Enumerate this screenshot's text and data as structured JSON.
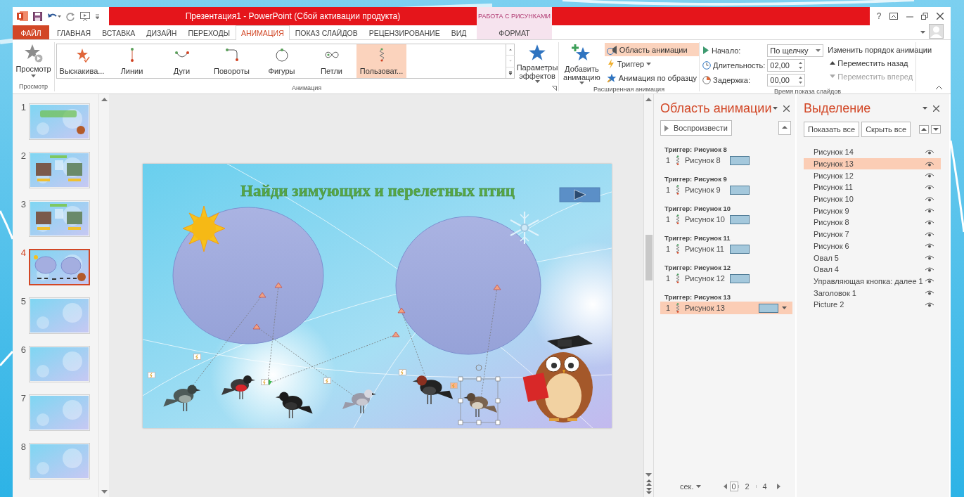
{
  "window": {
    "title": "Презентация1 -  PowerPoint (Сбой активации продукта)",
    "help": "?"
  },
  "contextual_group": {
    "label": "РАБОТА С РИСУНКАМИ"
  },
  "tabs": [
    {
      "label": "ФАЙЛ",
      "kind": "file",
      "selected": false
    },
    {
      "label": "ГЛАВНАЯ",
      "kind": "normal",
      "selected": false
    },
    {
      "label": "ВСТАВКА",
      "kind": "normal",
      "selected": false
    },
    {
      "label": "ДИЗАЙН",
      "kind": "normal",
      "selected": false
    },
    {
      "label": "ПЕРЕХОДЫ",
      "kind": "normal",
      "selected": false
    },
    {
      "label": "АНИМАЦИЯ",
      "kind": "normal",
      "selected": true
    },
    {
      "label": "ПОКАЗ СЛАЙДОВ",
      "kind": "normal",
      "selected": false
    },
    {
      "label": "РЕЦЕНЗИРОВАНИЕ",
      "kind": "normal",
      "selected": false
    },
    {
      "label": "ВИД",
      "kind": "normal",
      "selected": false
    },
    {
      "label": "ФОРМАТ",
      "kind": "contextual",
      "selected": false
    }
  ],
  "ribbon": {
    "preview": {
      "label": "Просмотр",
      "group_label": "Просмотр"
    },
    "animation": {
      "effects": [
        {
          "label": "Выскакива...",
          "kind": "pop",
          "selected": false
        },
        {
          "label": "Линии",
          "kind": "line",
          "selected": false
        },
        {
          "label": "Дуги",
          "kind": "arc",
          "selected": false
        },
        {
          "label": "Повороты",
          "kind": "turn",
          "selected": false
        },
        {
          "label": "Фигуры",
          "kind": "shape",
          "selected": false
        },
        {
          "label": "Петли",
          "kind": "loop",
          "selected": false
        },
        {
          "label": "Пользоват...",
          "kind": "custom",
          "selected": true
        }
      ],
      "effect_options": "Параметры эффектов",
      "group_label": "Анимация"
    },
    "advanced": {
      "add_animation": "Добавить анимацию",
      "animation_pane": {
        "label": "Область анимации",
        "on": true
      },
      "trigger": "Триггер",
      "animation_painter": "Анимация по образцу",
      "group_label": "Расширенная анимация"
    },
    "timing": {
      "start": {
        "label": "Начало:",
        "value": "По щелчку"
      },
      "duration": {
        "label": "Длительность:",
        "value": "02,00"
      },
      "delay": {
        "label": "Задержка:",
        "value": "00,00"
      },
      "reorder_heading": "Изменить порядок анимации",
      "move_earlier": {
        "label": "Переместить назад",
        "disabled": false
      },
      "move_later": {
        "label": "Переместить вперед",
        "disabled": true
      },
      "group_label": "Время показа слайдов"
    }
  },
  "thumbnails": [
    {
      "number": "1",
      "kind": "title",
      "selected": false
    },
    {
      "number": "2",
      "kind": "photos",
      "selected": false
    },
    {
      "number": "3",
      "kind": "photos",
      "selected": false
    },
    {
      "number": "4",
      "kind": "ovals",
      "selected": true
    },
    {
      "number": "5",
      "kind": "blank",
      "selected": false
    },
    {
      "number": "6",
      "kind": "blank",
      "selected": false
    },
    {
      "number": "7",
      "kind": "blank",
      "selected": false
    },
    {
      "number": "8",
      "kind": "blank",
      "selected": false
    }
  ],
  "slide": {
    "title": "Найди зимующих и перелетных птиц"
  },
  "animation_pane": {
    "title": "Область анимации",
    "play_button": "Воспроизвести",
    "groups": [
      {
        "trigger": "Триггер: Рисунок 8",
        "items": [
          {
            "order": "1",
            "name": "Рисунок 8",
            "selected": false
          }
        ]
      },
      {
        "trigger": "Триггер: Рисунок 9",
        "items": [
          {
            "order": "1",
            "name": "Рисунок 9",
            "selected": false
          }
        ]
      },
      {
        "trigger": "Триггер: Рисунок 10",
        "items": [
          {
            "order": "1",
            "name": "Рисунок 10",
            "selected": false
          }
        ]
      },
      {
        "trigger": "Триггер: Рисунок 11",
        "items": [
          {
            "order": "1",
            "name": "Рисунок 11",
            "selected": false
          }
        ]
      },
      {
        "trigger": "Триггер: Рисунок 12",
        "items": [
          {
            "order": "1",
            "name": "Рисунок 12",
            "selected": false
          }
        ]
      },
      {
        "trigger": "Триггер: Рисунок 13",
        "items": [
          {
            "order": "1",
            "name": "Рисунок 13",
            "selected": true
          }
        ]
      }
    ],
    "timeline": {
      "unit": "сек.",
      "ticks": [
        "0",
        "2",
        "4"
      ]
    }
  },
  "selection_pane": {
    "title": "Выделение",
    "show_all": "Показать все",
    "hide_all": "Скрыть все",
    "items": [
      {
        "name": "Рисунок 14",
        "selected": false,
        "visible": true
      },
      {
        "name": "Рисунок 13",
        "selected": true,
        "visible": true
      },
      {
        "name": "Рисунок 12",
        "selected": false,
        "visible": true
      },
      {
        "name": "Рисунок 11",
        "selected": false,
        "visible": true
      },
      {
        "name": "Рисунок 10",
        "selected": false,
        "visible": true
      },
      {
        "name": "Рисунок 9",
        "selected": false,
        "visible": true
      },
      {
        "name": "Рисунок 8",
        "selected": false,
        "visible": true
      },
      {
        "name": "Рисунок 7",
        "selected": false,
        "visible": true
      },
      {
        "name": "Рисунок 6",
        "selected": false,
        "visible": true
      },
      {
        "name": "Овал 5",
        "selected": false,
        "visible": true
      },
      {
        "name": "Овал 4",
        "selected": false,
        "visible": true
      },
      {
        "name": "Управляющая кнопка: далее 1",
        "selected": false,
        "visible": true
      },
      {
        "name": "Заголовок 1",
        "selected": false,
        "visible": true
      },
      {
        "name": "Picture 2",
        "selected": false,
        "visible": true
      }
    ]
  }
}
